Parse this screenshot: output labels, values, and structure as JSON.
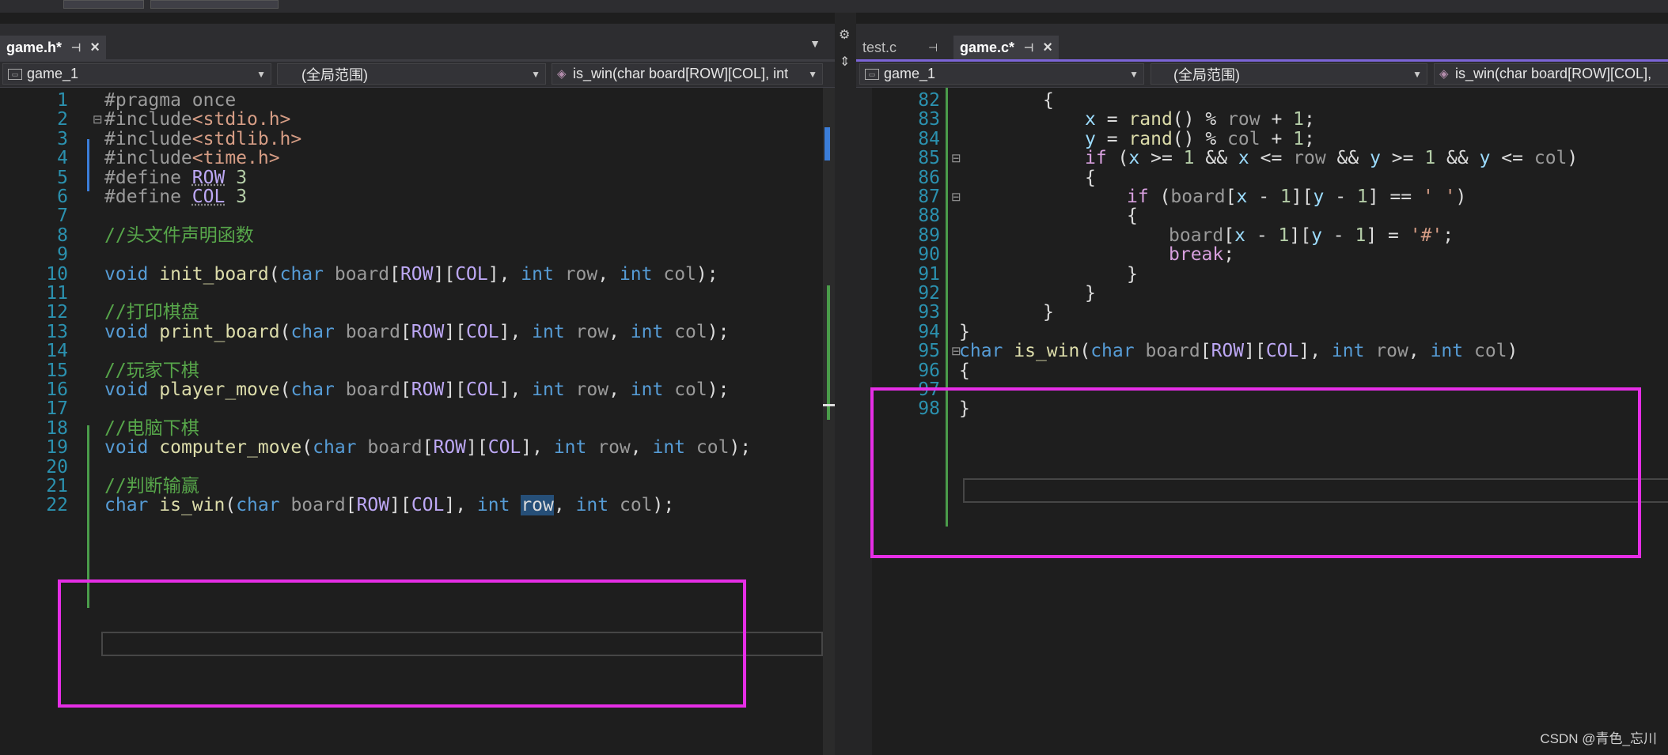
{
  "left": {
    "tabs": [
      {
        "label": "game.h*",
        "active": true
      }
    ],
    "nav": {
      "project": "game_1",
      "scope": "(全局范围)",
      "member": "is_win(char board[ROW][COL], int"
    },
    "lines": [
      {
        "n": "1",
        "tokens": [
          [
            "pp",
            "#pragma once"
          ]
        ]
      },
      {
        "n": "2",
        "tokens": [
          [
            "pp",
            "#include"
          ],
          [
            "inc",
            "<stdio.h>"
          ]
        ]
      },
      {
        "n": "3",
        "tokens": [
          [
            "pp",
            "#include"
          ],
          [
            "inc",
            "<stdlib.h>"
          ]
        ]
      },
      {
        "n": "4",
        "tokens": [
          [
            "pp",
            "#include"
          ],
          [
            "inc",
            "<time.h>"
          ]
        ]
      },
      {
        "n": "5",
        "tokens": [
          [
            "pp",
            "#define "
          ],
          [
            "mac",
            "ROW"
          ],
          [
            "t",
            " "
          ],
          [
            "num",
            "3"
          ]
        ]
      },
      {
        "n": "6",
        "tokens": [
          [
            "pp",
            "#define "
          ],
          [
            "mac",
            "COL"
          ],
          [
            "t",
            " "
          ],
          [
            "num",
            "3"
          ]
        ]
      },
      {
        "n": "7",
        "tokens": []
      },
      {
        "n": "8",
        "tokens": [
          [
            "cm",
            "//头文件声明函数"
          ]
        ]
      },
      {
        "n": "9",
        "tokens": []
      },
      {
        "n": "10",
        "tokens": [
          [
            "k",
            "void"
          ],
          [
            "t",
            " "
          ],
          [
            "fn",
            "init_board"
          ],
          [
            "t",
            "("
          ],
          [
            "k",
            "char"
          ],
          [
            "t",
            " "
          ],
          [
            "pl",
            "board"
          ],
          [
            "t",
            "["
          ],
          [
            "mac2",
            "ROW"
          ],
          [
            "t",
            "]["
          ],
          [
            "mac2",
            "COL"
          ],
          [
            "t",
            "], "
          ],
          [
            "k",
            "int"
          ],
          [
            "t",
            " "
          ],
          [
            "pl",
            "row"
          ],
          [
            "t",
            ", "
          ],
          [
            "k",
            "int"
          ],
          [
            "t",
            " "
          ],
          [
            "pl",
            "col"
          ],
          [
            "t",
            ");"
          ]
        ]
      },
      {
        "n": "11",
        "tokens": []
      },
      {
        "n": "12",
        "tokens": [
          [
            "cm",
            "//打印棋盘"
          ]
        ]
      },
      {
        "n": "13",
        "tokens": [
          [
            "k",
            "void"
          ],
          [
            "t",
            " "
          ],
          [
            "fn",
            "print_board"
          ],
          [
            "t",
            "("
          ],
          [
            "k",
            "char"
          ],
          [
            "t",
            " "
          ],
          [
            "pl",
            "board"
          ],
          [
            "t",
            "["
          ],
          [
            "mac2",
            "ROW"
          ],
          [
            "t",
            "]["
          ],
          [
            "mac2",
            "COL"
          ],
          [
            "t",
            "], "
          ],
          [
            "k",
            "int"
          ],
          [
            "t",
            " "
          ],
          [
            "pl",
            "row"
          ],
          [
            "t",
            ", "
          ],
          [
            "k",
            "int"
          ],
          [
            "t",
            " "
          ],
          [
            "pl",
            "col"
          ],
          [
            "t",
            ");"
          ]
        ]
      },
      {
        "n": "14",
        "tokens": []
      },
      {
        "n": "15",
        "tokens": [
          [
            "cm",
            "//玩家下棋"
          ]
        ]
      },
      {
        "n": "16",
        "tokens": [
          [
            "k",
            "void"
          ],
          [
            "t",
            " "
          ],
          [
            "fn",
            "player_move"
          ],
          [
            "t",
            "("
          ],
          [
            "k",
            "char"
          ],
          [
            "t",
            " "
          ],
          [
            "pl",
            "board"
          ],
          [
            "t",
            "["
          ],
          [
            "mac2",
            "ROW"
          ],
          [
            "t",
            "]["
          ],
          [
            "mac2",
            "COL"
          ],
          [
            "t",
            "], "
          ],
          [
            "k",
            "int"
          ],
          [
            "t",
            " "
          ],
          [
            "pl",
            "row"
          ],
          [
            "t",
            ", "
          ],
          [
            "k",
            "int"
          ],
          [
            "t",
            " "
          ],
          [
            "pl",
            "col"
          ],
          [
            "t",
            ");"
          ]
        ]
      },
      {
        "n": "17",
        "tokens": []
      },
      {
        "n": "18",
        "tokens": [
          [
            "cm",
            "//电脑下棋"
          ]
        ]
      },
      {
        "n": "19",
        "tokens": [
          [
            "k",
            "void"
          ],
          [
            "t",
            " "
          ],
          [
            "fn",
            "computer_move"
          ],
          [
            "t",
            "("
          ],
          [
            "k",
            "char"
          ],
          [
            "t",
            " "
          ],
          [
            "pl",
            "board"
          ],
          [
            "t",
            "["
          ],
          [
            "mac2",
            "ROW"
          ],
          [
            "t",
            "]["
          ],
          [
            "mac2",
            "COL"
          ],
          [
            "t",
            "], "
          ],
          [
            "k",
            "int"
          ],
          [
            "t",
            " "
          ],
          [
            "pl",
            "row"
          ],
          [
            "t",
            ", "
          ],
          [
            "k",
            "int"
          ],
          [
            "t",
            " "
          ],
          [
            "pl",
            "col"
          ],
          [
            "t",
            ");"
          ]
        ]
      },
      {
        "n": "20",
        "tokens": []
      },
      {
        "n": "21",
        "tokens": [
          [
            "cm",
            "//判断输赢"
          ]
        ]
      },
      {
        "n": "22",
        "tokens": [
          [
            "k",
            "char"
          ],
          [
            "t",
            " "
          ],
          [
            "fn",
            "is_win"
          ],
          [
            "t",
            "("
          ],
          [
            "k",
            "char"
          ],
          [
            "t",
            " "
          ],
          [
            "pl",
            "board"
          ],
          [
            "t",
            "["
          ],
          [
            "mac2",
            "ROW"
          ],
          [
            "t",
            "]["
          ],
          [
            "mac2",
            "COL"
          ],
          [
            "t",
            "], "
          ],
          [
            "k",
            "int"
          ],
          [
            "t",
            " "
          ],
          [
            "sel",
            "row"
          ],
          [
            "t",
            ", "
          ],
          [
            "k",
            "int"
          ],
          [
            "t",
            " "
          ],
          [
            "pl",
            "col"
          ],
          [
            "t",
            ");"
          ]
        ]
      }
    ]
  },
  "right": {
    "tabs": [
      {
        "label": "test.c",
        "active": false
      },
      {
        "label": "game.c*",
        "active": true
      }
    ],
    "nav": {
      "project": "game_1",
      "scope": "(全局范围)",
      "member": "is_win(char board[ROW][COL],"
    },
    "lines": [
      {
        "n": "82",
        "indent": 2,
        "tokens": [
          [
            "t",
            "{"
          ]
        ]
      },
      {
        "n": "83",
        "indent": 3,
        "tokens": [
          [
            "var",
            "x"
          ],
          [
            "t",
            " = "
          ],
          [
            "fn",
            "rand"
          ],
          [
            "t",
            "() % "
          ],
          [
            "pl",
            "row"
          ],
          [
            "t",
            " + "
          ],
          [
            "num",
            "1"
          ],
          [
            "t",
            ";"
          ]
        ]
      },
      {
        "n": "84",
        "indent": 3,
        "tokens": [
          [
            "var",
            "y"
          ],
          [
            "t",
            " = "
          ],
          [
            "fn",
            "rand"
          ],
          [
            "t",
            "() % "
          ],
          [
            "pl",
            "col"
          ],
          [
            "t",
            " + "
          ],
          [
            "num",
            "1"
          ],
          [
            "t",
            ";"
          ]
        ]
      },
      {
        "n": "85",
        "indent": 3,
        "tokens": [
          [
            "ctl",
            "if"
          ],
          [
            "t",
            " ("
          ],
          [
            "var",
            "x"
          ],
          [
            "t",
            " >= "
          ],
          [
            "num",
            "1"
          ],
          [
            "t",
            " && "
          ],
          [
            "var",
            "x"
          ],
          [
            "t",
            " <= "
          ],
          [
            "pl",
            "row"
          ],
          [
            "t",
            " && "
          ],
          [
            "var",
            "y"
          ],
          [
            "t",
            " >= "
          ],
          [
            "num",
            "1"
          ],
          [
            "t",
            " && "
          ],
          [
            "var",
            "y"
          ],
          [
            "t",
            " <= "
          ],
          [
            "pl",
            "col"
          ],
          [
            "t",
            ")"
          ]
        ]
      },
      {
        "n": "86",
        "indent": 3,
        "tokens": [
          [
            "t",
            "{"
          ]
        ]
      },
      {
        "n": "87",
        "indent": 4,
        "tokens": [
          [
            "ctl",
            "if"
          ],
          [
            "t",
            " ("
          ],
          [
            "pl",
            "board"
          ],
          [
            "t",
            "["
          ],
          [
            "var",
            "x"
          ],
          [
            "t",
            " - "
          ],
          [
            "num",
            "1"
          ],
          [
            "t",
            "]["
          ],
          [
            "var",
            "y"
          ],
          [
            "t",
            " - "
          ],
          [
            "num",
            "1"
          ],
          [
            "t",
            "] == "
          ],
          [
            "str",
            "' '"
          ],
          [
            "t",
            ")"
          ]
        ]
      },
      {
        "n": "88",
        "indent": 4,
        "tokens": [
          [
            "t",
            "{"
          ]
        ]
      },
      {
        "n": "89",
        "indent": 5,
        "tokens": [
          [
            "pl",
            "board"
          ],
          [
            "t",
            "["
          ],
          [
            "var",
            "x"
          ],
          [
            "t",
            " - "
          ],
          [
            "num",
            "1"
          ],
          [
            "t",
            "]["
          ],
          [
            "var",
            "y"
          ],
          [
            "t",
            " - "
          ],
          [
            "num",
            "1"
          ],
          [
            "t",
            "] = "
          ],
          [
            "str",
            "'#'"
          ],
          [
            "t",
            ";"
          ]
        ]
      },
      {
        "n": "90",
        "indent": 5,
        "tokens": [
          [
            "ctl",
            "break"
          ],
          [
            "t",
            ";"
          ]
        ]
      },
      {
        "n": "91",
        "indent": 4,
        "tokens": [
          [
            "t",
            "}"
          ]
        ]
      },
      {
        "n": "92",
        "indent": 3,
        "tokens": [
          [
            "t",
            "}"
          ]
        ]
      },
      {
        "n": "93",
        "indent": 2,
        "tokens": [
          [
            "t",
            "}"
          ]
        ]
      },
      {
        "n": "94",
        "indent": 0,
        "tokens": [
          [
            "t",
            "}"
          ]
        ]
      },
      {
        "n": "95",
        "indent": 0,
        "tokens": [
          [
            "k",
            "char"
          ],
          [
            "t",
            " "
          ],
          [
            "fn",
            "is_win"
          ],
          [
            "t",
            "("
          ],
          [
            "k",
            "char"
          ],
          [
            "t",
            " "
          ],
          [
            "pl",
            "board"
          ],
          [
            "t",
            "["
          ],
          [
            "mac2",
            "ROW"
          ],
          [
            "t",
            "]["
          ],
          [
            "mac2",
            "COL"
          ],
          [
            "t",
            "], "
          ],
          [
            "k",
            "int"
          ],
          [
            "t",
            " "
          ],
          [
            "pl",
            "row"
          ],
          [
            "t",
            ", "
          ],
          [
            "k",
            "int"
          ],
          [
            "t",
            " "
          ],
          [
            "pl",
            "col"
          ],
          [
            "t",
            ")"
          ]
        ]
      },
      {
        "n": "96",
        "indent": 0,
        "tokens": [
          [
            "t",
            "{"
          ]
        ]
      },
      {
        "n": "97",
        "indent": 0,
        "tokens": []
      },
      {
        "n": "98",
        "indent": 0,
        "tokens": [
          [
            "t",
            "}"
          ]
        ]
      }
    ]
  },
  "watermark": "CSDN @青色_忘川"
}
